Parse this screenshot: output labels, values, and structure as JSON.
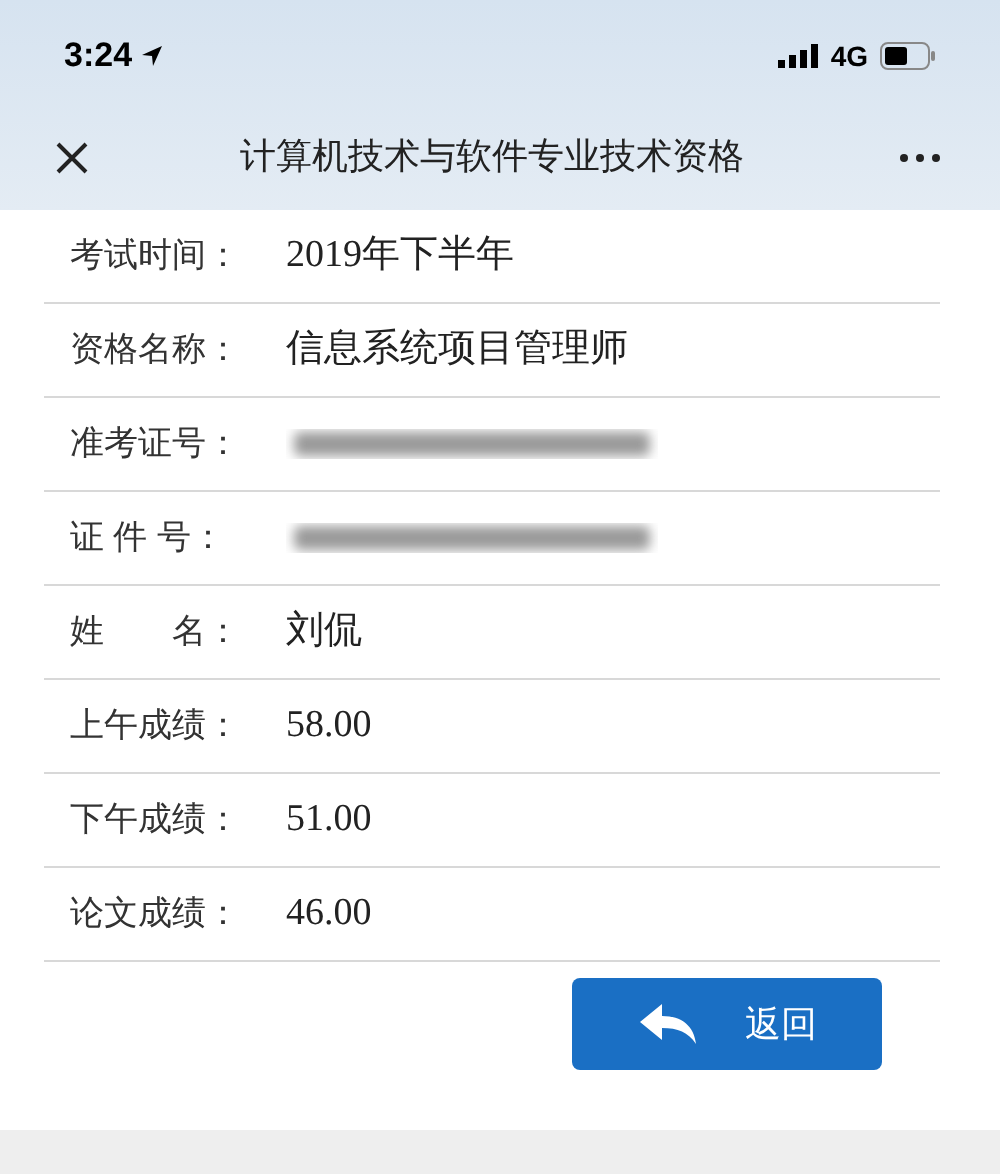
{
  "status_bar": {
    "time": "3:24",
    "network": "4G"
  },
  "header": {
    "title": "计算机技术与软件专业技术资格"
  },
  "rows": [
    {
      "label": "考试时间：",
      "value": "2019年下半年",
      "redacted": false
    },
    {
      "label": "资格名称：",
      "value": "信息系统项目管理师",
      "redacted": false
    },
    {
      "label": "准考证号：",
      "redacted": true
    },
    {
      "label": "证 件 号：",
      "redacted": true
    },
    {
      "label": "姓　　名：",
      "value": "刘侃",
      "redacted": false
    },
    {
      "label": "上午成绩：",
      "value": "58.00",
      "redacted": false
    },
    {
      "label": "下午成绩：",
      "value": "51.00",
      "redacted": false
    },
    {
      "label": "论文成绩：",
      "value": "46.00",
      "redacted": false
    }
  ],
  "back_button": {
    "label": "返回"
  }
}
